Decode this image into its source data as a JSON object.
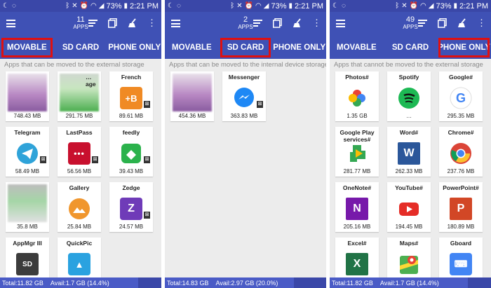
{
  "status": {
    "battery": "73%",
    "time": "2:21 PM"
  },
  "panels": [
    {
      "count": "11",
      "count_label": "APPS",
      "tabs": [
        "MOVABLE",
        "SD CARD",
        "PHONE ONLY"
      ],
      "highlight_tab": 0,
      "description": "Apps that can be moved to the external storage",
      "apps": [
        {
          "name": "",
          "size": "748.43 MB",
          "icon": "blurred",
          "badge": false
        },
        {
          "name": "…age",
          "size": "291.75 MB",
          "icon": "blurred-green",
          "badge": false
        },
        {
          "name": "French",
          "size": "89.61 MB",
          "icon": "french-icon",
          "badge": true
        },
        {
          "name": "Telegram",
          "size": "58.49 MB",
          "icon": "telegram-icon",
          "badge": true
        },
        {
          "name": "LastPass",
          "size": "56.56 MB",
          "icon": "lastpass-icon",
          "badge": true
        },
        {
          "name": "feedly",
          "size": "39.43 MB",
          "icon": "feedly-icon",
          "badge": true
        },
        {
          "name": "",
          "size": "35.8 MB",
          "icon": "blurred-map",
          "badge": false
        },
        {
          "name": "Gallery",
          "size": "25.84 MB",
          "icon": "gallery-icon",
          "badge": false
        },
        {
          "name": "Zedge",
          "size": "24.57 MB",
          "icon": "zedge-icon",
          "badge": true
        },
        {
          "name": "AppMgr III",
          "size": "",
          "icon": "appmgr-icon",
          "badge": false
        },
        {
          "name": "QuickPic",
          "size": "",
          "icon": "quickpic-icon",
          "badge": false
        }
      ],
      "footer": {
        "total": "Total:11.82 GB",
        "avail": "Avail:1.7 GB (14.4%)",
        "used_fraction": 0.856
      }
    },
    {
      "count": "2",
      "count_label": "APPS",
      "tabs": [
        "MOVABLE",
        "SD CARD",
        "PHONE ONLY"
      ],
      "highlight_tab": 1,
      "description": "Apps that can be moved to the internal device storage",
      "apps": [
        {
          "name": "",
          "size": "454.36 MB",
          "icon": "blurred",
          "badge": false
        },
        {
          "name": "Messenger",
          "size": "363.83 MB",
          "icon": "messenger-icon",
          "badge": true
        }
      ],
      "footer": {
        "total": "Total:14.83 GB",
        "avail": "Avail:2.97 GB (20.0%)",
        "used_fraction": 0.8
      }
    },
    {
      "count": "49",
      "count_label": "APPS",
      "tabs": [
        "MOVABLE",
        "SD CARD",
        "PHONE ONLY"
      ],
      "highlight_tab": 2,
      "description": "Apps that cannot be moved to the external storage",
      "apps": [
        {
          "name": "Photos#",
          "size": "1.35 GB",
          "icon": "photos-icon",
          "badge": false
        },
        {
          "name": "Spotify",
          "size": "…",
          "icon": "spotify-icon",
          "badge": false
        },
        {
          "name": "Google#",
          "size": "295.35 MB",
          "icon": "google-icon",
          "badge": false
        },
        {
          "name": "Google Play services#",
          "size": "281.77 MB",
          "icon": "play-services-icon",
          "badge": false
        },
        {
          "name": "Word#",
          "size": "262.33 MB",
          "icon": "word-icon",
          "badge": false
        },
        {
          "name": "Chrome#",
          "size": "237.76 MB",
          "icon": "chrome-icon",
          "badge": false
        },
        {
          "name": "OneNote#",
          "size": "205.16 MB",
          "icon": "onenote-icon",
          "badge": false
        },
        {
          "name": "YouTube#",
          "size": "194.45 MB",
          "icon": "youtube-icon",
          "badge": false
        },
        {
          "name": "PowerPoint#",
          "size": "180.89 MB",
          "icon": "powerpoint-icon",
          "badge": false
        },
        {
          "name": "Excel#",
          "size": "",
          "icon": "excel-icon",
          "badge": false
        },
        {
          "name": "Maps#",
          "size": "",
          "icon": "maps-icon",
          "badge": false
        },
        {
          "name": "Gboard",
          "size": "",
          "icon": "gboard-icon",
          "badge": false
        }
      ],
      "footer": {
        "total": "Total:11.82 GB",
        "avail": "Avail:1.7 GB (14.4%)",
        "used_fraction": 0.856
      }
    }
  ],
  "colors": {
    "toolbar": "#3f51b5",
    "highlight": "#e01010"
  }
}
